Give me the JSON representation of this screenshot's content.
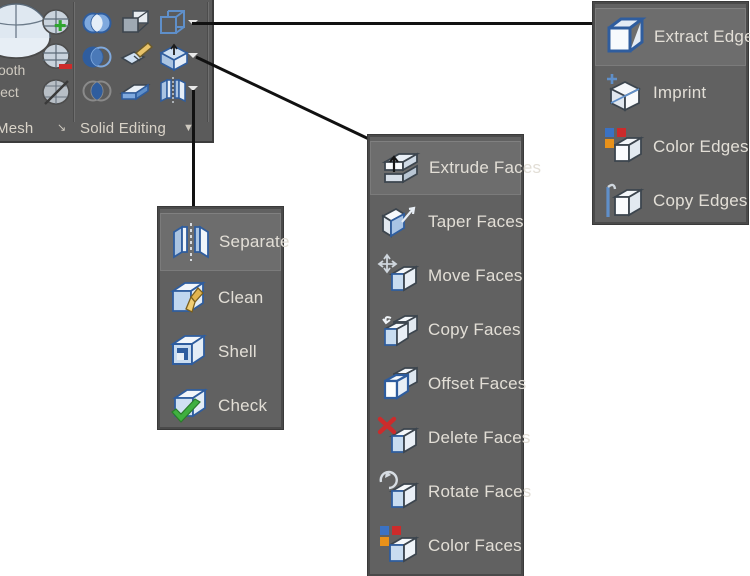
{
  "ribbon": {
    "panels": [
      {
        "name": "mesh",
        "title": "Mesh",
        "expand_glyph": "↘"
      },
      {
        "name": "solid-editing",
        "title": "Solid Editing",
        "expand_glyph": "▼"
      }
    ],
    "mesh_labels": [
      "ooth",
      "ject"
    ],
    "mesh_tools": [
      {
        "name": "smooth-object-big-icon",
        "label": ""
      },
      {
        "name": "mesh-refine-icon",
        "label": ""
      },
      {
        "name": "mesh-less-icon",
        "label": ""
      },
      {
        "name": "no-smooth-icon",
        "label": ""
      }
    ],
    "solid_tools": [
      {
        "name": "union-icon"
      },
      {
        "name": "solid-extrude-face-icon"
      },
      {
        "name": "extract-edges-icon"
      },
      {
        "name": "subtract-icon"
      },
      {
        "name": "imprint-icon"
      },
      {
        "name": "extrude-faces-icon"
      },
      {
        "name": "intersect-icon"
      },
      {
        "name": "clean-icon"
      },
      {
        "name": "separate-icon"
      }
    ],
    "dropdown_arrows": [
      "edges-dropdown-arrow",
      "faces-dropdown-arrow",
      "body-dropdown-arrow"
    ]
  },
  "flyouts": [
    {
      "name": "edges-flyout",
      "items": [
        {
          "label": "Extract Edges",
          "icon": "extract-edges-icon",
          "selected": true
        },
        {
          "label": "Imprint",
          "icon": "imprint-icon",
          "selected": false
        },
        {
          "label": "Color Edges",
          "icon": "color-edges-icon",
          "selected": false
        },
        {
          "label": "Copy Edges",
          "icon": "copy-edges-icon",
          "selected": false
        }
      ]
    },
    {
      "name": "faces-flyout",
      "items": [
        {
          "label": "Extrude Faces",
          "icon": "extrude-faces-icon",
          "selected": true
        },
        {
          "label": "Taper Faces",
          "icon": "taper-faces-icon",
          "selected": false
        },
        {
          "label": "Move Faces",
          "icon": "move-faces-icon",
          "selected": false
        },
        {
          "label": "Copy Faces",
          "icon": "copy-faces-icon",
          "selected": false
        },
        {
          "label": "Offset Faces",
          "icon": "offset-faces-icon",
          "selected": false
        },
        {
          "label": "Delete Faces",
          "icon": "delete-faces-icon",
          "selected": false
        },
        {
          "label": "Rotate Faces",
          "icon": "rotate-faces-icon",
          "selected": false
        },
        {
          "label": "Color Faces",
          "icon": "color-faces-icon",
          "selected": false
        }
      ]
    },
    {
      "name": "body-flyout",
      "items": [
        {
          "label": "Separate",
          "icon": "separate-icon",
          "selected": true
        },
        {
          "label": "Clean",
          "icon": "clean-icon",
          "selected": false
        },
        {
          "label": "Shell",
          "icon": "shell-icon",
          "selected": false
        },
        {
          "label": "Check",
          "icon": "check-icon",
          "selected": false
        }
      ]
    }
  ],
  "colors": {
    "ribbon_bg": "#5b5b5b",
    "flyout_bg": "#616161",
    "selected_bg": "#6d6d6d",
    "text": "#e2ded6",
    "accent_blue": "#2f5d9e",
    "face_light": "#cfe0f2",
    "connector": "#111111"
  }
}
